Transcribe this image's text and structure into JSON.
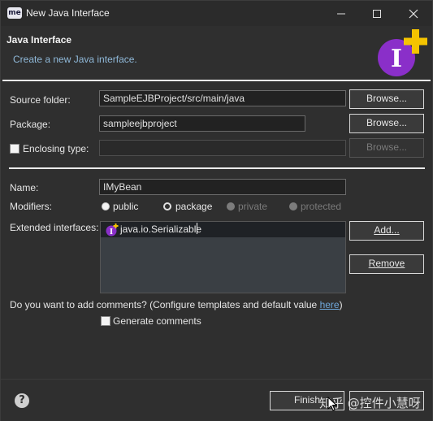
{
  "titlebar": {
    "app_badge": "me",
    "title": "New Java Interface"
  },
  "header": {
    "title": "Java Interface",
    "description": "Create a new Java interface."
  },
  "source_folder": {
    "label": "Source folder:",
    "value": "SampleEJBProject/src/main/java",
    "browse": "Browse..."
  },
  "package": {
    "label": "Package:",
    "value": "sampleejbproject",
    "browse": "Browse..."
  },
  "enclosing_type": {
    "label": "Enclosing type:",
    "value": "",
    "browse": "Browse...",
    "checked": false
  },
  "name": {
    "label": "Name:",
    "value": "IMyBean"
  },
  "modifiers": {
    "label": "Modifiers:",
    "options": [
      {
        "label": "public",
        "selected": false,
        "enabled": true
      },
      {
        "label": "package",
        "selected": true,
        "enabled": true
      },
      {
        "label": "private",
        "selected": false,
        "enabled": false
      },
      {
        "label": "protected",
        "selected": false,
        "enabled": false
      }
    ]
  },
  "extended_interfaces": {
    "label": "Extended interfaces:",
    "items": [
      "java.io.Serializable"
    ],
    "add": "Add...",
    "remove": "Remove"
  },
  "comments": {
    "question": "Do you want to add comments? (Configure templates and default value ",
    "link": "here",
    "suffix": ")",
    "generate_label": "Generate comments",
    "checked": false
  },
  "footer": {
    "help": "?",
    "finish": "Finish",
    "watermark": "知乎 @控件小慧呀"
  },
  "colors": {
    "background": "#2f2f2f",
    "field_bg": "#222222",
    "link": "#6fa8dc",
    "icon_purple": "#8a2fc9",
    "icon_plus": "#f5c400"
  }
}
